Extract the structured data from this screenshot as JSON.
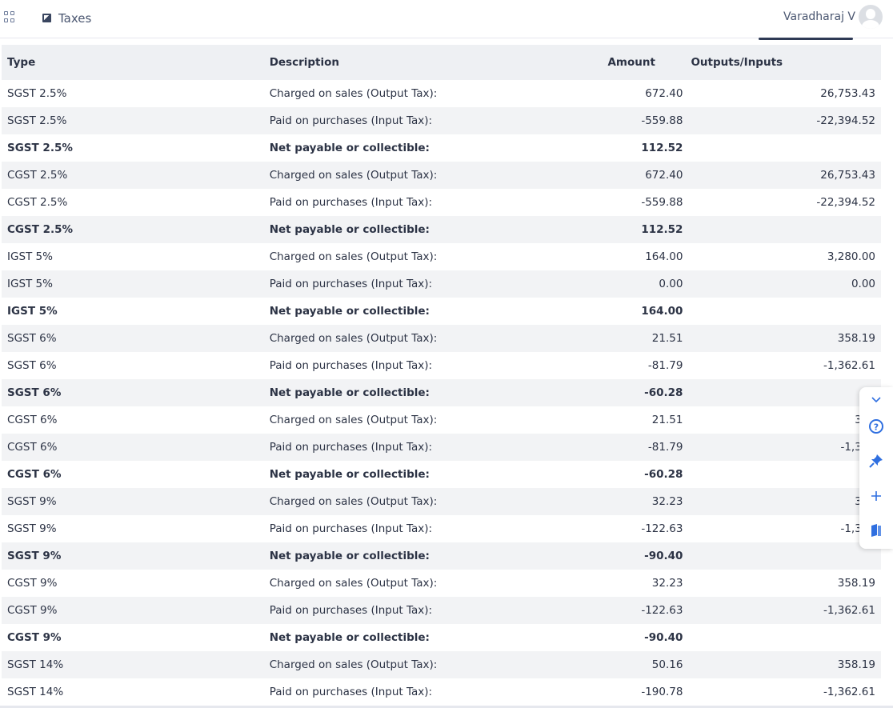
{
  "header": {
    "page_title": "Taxes",
    "user_name": "Varadharaj V"
  },
  "table": {
    "columns": [
      "Type",
      "Description",
      "Amount",
      "Outputs/Inputs"
    ],
    "rows": [
      {
        "type": "SGST 2.5%",
        "description": "Charged on sales (Output Tax):",
        "amount": "672.40",
        "outputs": "26,753.43",
        "total": false
      },
      {
        "type": "SGST 2.5%",
        "description": "Paid on purchases (Input Tax):",
        "amount": "-559.88",
        "outputs": "-22,394.52",
        "total": false
      },
      {
        "type": "SGST 2.5%",
        "description": "Net payable or collectible:",
        "amount": "112.52",
        "outputs": "",
        "total": true
      },
      {
        "type": "CGST 2.5%",
        "description": "Charged on sales (Output Tax):",
        "amount": "672.40",
        "outputs": "26,753.43",
        "total": false
      },
      {
        "type": "CGST 2.5%",
        "description": "Paid on purchases (Input Tax):",
        "amount": "-559.88",
        "outputs": "-22,394.52",
        "total": false
      },
      {
        "type": "CGST 2.5%",
        "description": "Net payable or collectible:",
        "amount": "112.52",
        "outputs": "",
        "total": true
      },
      {
        "type": "IGST 5%",
        "description": "Charged on sales (Output Tax):",
        "amount": "164.00",
        "outputs": "3,280.00",
        "total": false
      },
      {
        "type": "IGST 5%",
        "description": "Paid on purchases (Input Tax):",
        "amount": "0.00",
        "outputs": "0.00",
        "total": false
      },
      {
        "type": "IGST 5%",
        "description": "Net payable or collectible:",
        "amount": "164.00",
        "outputs": "",
        "total": true
      },
      {
        "type": "SGST 6%",
        "description": "Charged on sales (Output Tax):",
        "amount": "21.51",
        "outputs": "358.19",
        "total": false
      },
      {
        "type": "SGST 6%",
        "description": "Paid on purchases (Input Tax):",
        "amount": "-81.79",
        "outputs": "-1,362.61",
        "total": false
      },
      {
        "type": "SGST 6%",
        "description": "Net payable or collectible:",
        "amount": "-60.28",
        "outputs": "",
        "total": true
      },
      {
        "type": "CGST 6%",
        "description": "Charged on sales (Output Tax):",
        "amount": "21.51",
        "outputs": "358",
        "total": false
      },
      {
        "type": "CGST 6%",
        "description": "Paid on purchases (Input Tax):",
        "amount": "-81.79",
        "outputs": "-1,362",
        "total": false
      },
      {
        "type": "CGST 6%",
        "description": "Net payable or collectible:",
        "amount": "-60.28",
        "outputs": "",
        "total": true
      },
      {
        "type": "SGST 9%",
        "description": "Charged on sales (Output Tax):",
        "amount": "32.23",
        "outputs": "358",
        "total": false
      },
      {
        "type": "SGST 9%",
        "description": "Paid on purchases (Input Tax):",
        "amount": "-122.63",
        "outputs": "-1,362",
        "total": false
      },
      {
        "type": "SGST 9%",
        "description": "Net payable or collectible:",
        "amount": "-90.40",
        "outputs": "",
        "total": true
      },
      {
        "type": "CGST 9%",
        "description": "Charged on sales (Output Tax):",
        "amount": "32.23",
        "outputs": "358.19",
        "total": false
      },
      {
        "type": "CGST 9%",
        "description": "Paid on purchases (Input Tax):",
        "amount": "-122.63",
        "outputs": "-1,362.61",
        "total": false
      },
      {
        "type": "CGST 9%",
        "description": "Net payable or collectible:",
        "amount": "-90.40",
        "outputs": "",
        "total": true
      },
      {
        "type": "SGST 14%",
        "description": "Charged on sales (Output Tax):",
        "amount": "50.16",
        "outputs": "358.19",
        "total": false
      },
      {
        "type": "SGST 14%",
        "description": "Paid on purchases (Input Tax):",
        "amount": "-190.78",
        "outputs": "-1,362.61",
        "total": false
      }
    ]
  },
  "side_panel": {
    "icons": [
      "chevron-down-icon",
      "help-icon",
      "pin-icon",
      "plus-icon",
      "book-icon"
    ],
    "accent": "#2f6fe0"
  },
  "colors": {
    "header_bg": "#eef0f3",
    "stripe_bg": "#f2f3f5",
    "text": "#2c3345"
  }
}
